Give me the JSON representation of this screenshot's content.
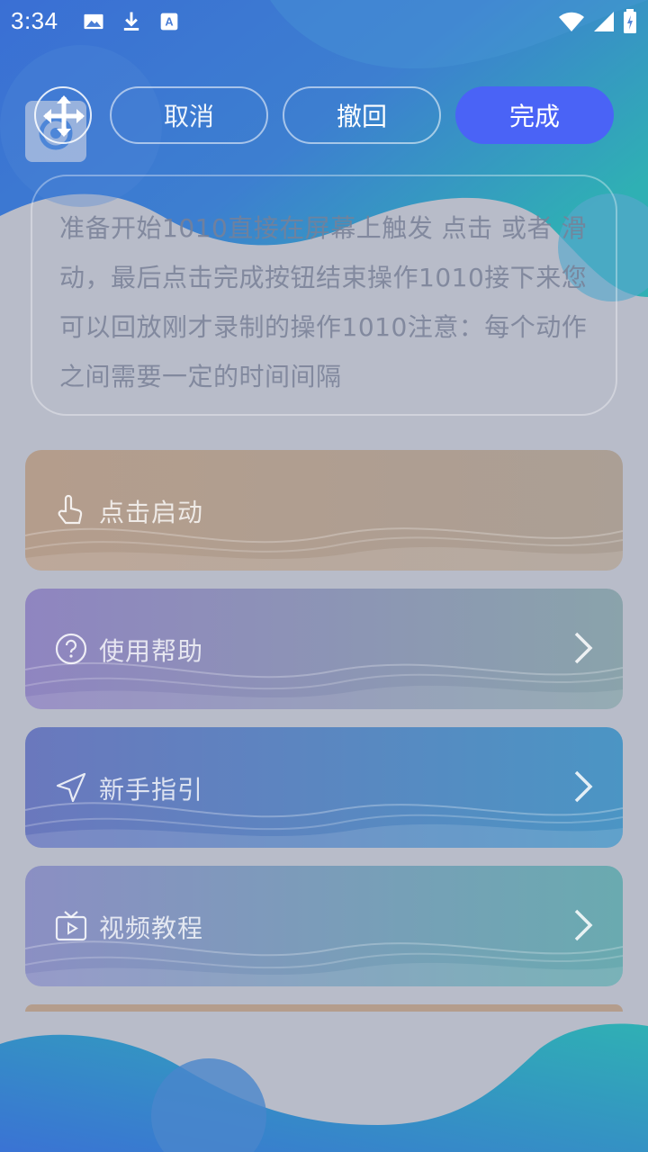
{
  "status_bar": {
    "time": "3:34",
    "left_icons": [
      "image-icon",
      "download-icon",
      "font-icon"
    ],
    "right_icons": [
      "wifi-icon",
      "signal-icon",
      "battery-charging-icon"
    ]
  },
  "toolbar": {
    "cancel_label": "取消",
    "undo_label": "撤回",
    "done_label": "完成"
  },
  "instruction_text": "准备开始1010直接在屏幕上触发 点击 或者 滑动，最后点击完成按钮结束操作1010接下来您可以回放刚才录制的操作1010注意：每个动作之间需要一定的时间间隔",
  "menu": [
    {
      "label": "点击启动",
      "icon": "tap-hand-icon",
      "has_chevron": false
    },
    {
      "label": "使用帮助",
      "icon": "help-circle-icon",
      "has_chevron": true
    },
    {
      "label": "新手指引",
      "icon": "navigation-arrow-icon",
      "has_chevron": true
    },
    {
      "label": "视频教程",
      "icon": "tv-play-icon",
      "has_chevron": true
    }
  ],
  "colors": {
    "done_button": "#4a63f6",
    "top_blue": "#3a6fd4",
    "teal": "#2fb0b4"
  }
}
